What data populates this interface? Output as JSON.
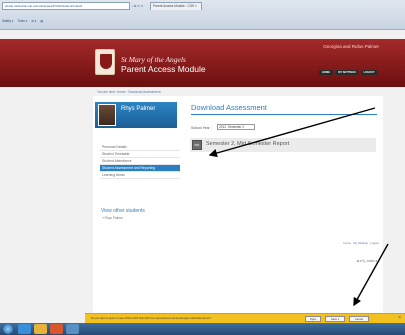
{
  "browser": {
    "address": "ahsdu.cathedral.edu.au/mobile/paa/Profile/Student/Index#",
    "nav_controls": "• ⊠ ↺ ✕",
    "tab_title": "Parent Access Module - CSS ×",
    "command_bar": [
      "Safety ▾",
      "Tools ▾",
      "⚙ ▾",
      "▤"
    ]
  },
  "header": {
    "school_name": "St Mary of the Angels",
    "portal_name": "Parent Access Module",
    "parent_name": "Georgina and Rufus Palmer",
    "buttons": [
      "HOME",
      "MY SETTINGS",
      "LOGOUT"
    ]
  },
  "breadcrumb": "You are here: Home › Download Assessment",
  "profile": {
    "student_name": "Rhys Palmer"
  },
  "menu": {
    "items": [
      {
        "label": "Personal Details",
        "active": false
      },
      {
        "label": "Student Timetable",
        "active": false
      },
      {
        "label": "Student Attendance",
        "active": false
      },
      {
        "label": "Student Assessment and Reporting",
        "active": true
      },
      {
        "label": "Learning Areas",
        "active": false
      }
    ],
    "view_other_label": "View other students",
    "other_student": "» Rhys Palmer"
  },
  "panel": {
    "title": "Download Assessment",
    "year_label": "School Year :",
    "year_value": "2012, Semester 2",
    "pdf_icon_label": "PDF",
    "report_title": "Semester 2, Mid Semester Report"
  },
  "footer": {
    "links": "Home · My Settings · Logout",
    "zoom": "⊕ ▾ 🔍 100% ▾"
  },
  "download_bar": {
    "text": "Do you want to open or save 2012-2-MIT-4012.pdf from parentaccess.stmaryofangels.cathedral.edu.au?",
    "buttons": [
      "Open",
      "Save ▾",
      "Cancel"
    ],
    "close": "×"
  },
  "colors": {
    "header_maroon": "#8a1a1a",
    "accent_blue": "#2c7fc0",
    "download_bar": "#f3c11f"
  }
}
